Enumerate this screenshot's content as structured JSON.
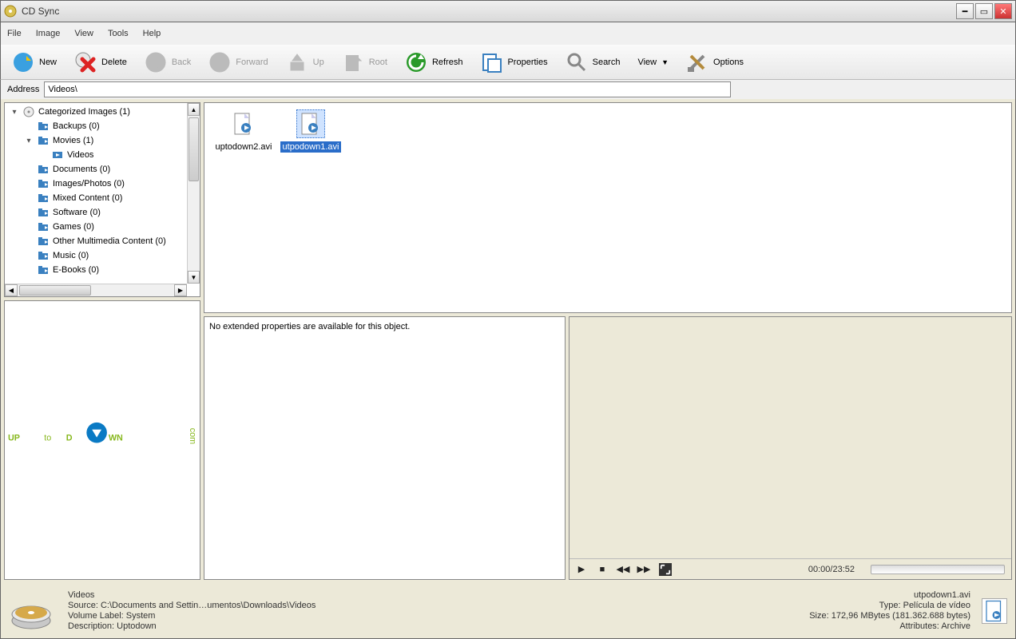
{
  "window": {
    "title": "CD Sync"
  },
  "menu": {
    "file": "File",
    "image": "Image",
    "view": "View",
    "tools": "Tools",
    "help": "Help"
  },
  "toolbar": {
    "new": "New",
    "delete": "Delete",
    "back": "Back",
    "forward": "Forward",
    "up": "Up",
    "root": "Root",
    "refresh": "Refresh",
    "properties": "Properties",
    "search": "Search",
    "view": "View",
    "options": "Options"
  },
  "addressbar": {
    "label": "Address",
    "value": "Videos\\"
  },
  "tree": {
    "items": [
      {
        "indent": 0,
        "expander": "▾",
        "icon": "disc",
        "label": "Categorized Images (1)"
      },
      {
        "indent": 1,
        "expander": "",
        "icon": "folder",
        "label": "Backups (0)"
      },
      {
        "indent": 1,
        "expander": "▾",
        "icon": "folder",
        "label": "Movies (1)"
      },
      {
        "indent": 2,
        "expander": "",
        "icon": "video",
        "label": "Videos"
      },
      {
        "indent": 1,
        "expander": "",
        "icon": "folder",
        "label": "Documents (0)"
      },
      {
        "indent": 1,
        "expander": "",
        "icon": "folder",
        "label": "Images/Photos (0)"
      },
      {
        "indent": 1,
        "expander": "",
        "icon": "folder",
        "label": "Mixed Content (0)"
      },
      {
        "indent": 1,
        "expander": "",
        "icon": "folder",
        "label": "Software (0)"
      },
      {
        "indent": 1,
        "expander": "",
        "icon": "folder",
        "label": "Games (0)"
      },
      {
        "indent": 1,
        "expander": "",
        "icon": "folder",
        "label": "Other Multimedia Content (0)"
      },
      {
        "indent": 1,
        "expander": "",
        "icon": "folder",
        "label": "Music (0)"
      },
      {
        "indent": 1,
        "expander": "",
        "icon": "folder",
        "label": "E-Books (0)"
      }
    ]
  },
  "files": [
    {
      "name": "uptodown2.avi",
      "selected": false
    },
    {
      "name": "utpodown1.avi",
      "selected": true
    }
  ],
  "properties": {
    "message": "No extended properties are available for this object."
  },
  "player": {
    "time": "00:00/23:52"
  },
  "status": {
    "left": {
      "folder": "Videos",
      "source": "Source: C:\\Documents and Settin…umentos\\Downloads\\Videos",
      "volume": "Volume Label: System",
      "description": "Description: Uptodown"
    },
    "right": {
      "filename": "utpodown1.avi",
      "type": "Type: Película de vídeo",
      "size": "Size: 172,96  MBytes (181.362.688 bytes)",
      "attrs": "Attributes: Archive"
    }
  }
}
